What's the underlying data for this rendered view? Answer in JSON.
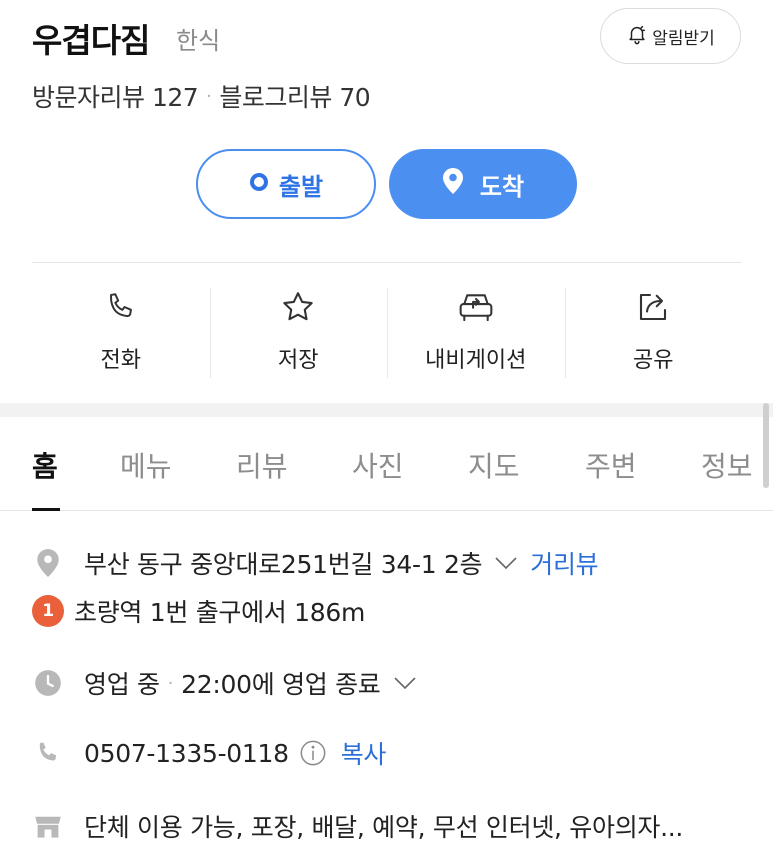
{
  "place": {
    "name": "우겹다짐",
    "category": "한식",
    "alarm_label": "알림받기"
  },
  "reviews": {
    "visitor_label": "방문자리뷰 127",
    "blog_label": "블로그리뷰 70",
    "separator": "·"
  },
  "route": {
    "start_label": "출발",
    "arrive_label": "도착"
  },
  "actions": [
    {
      "label": "전화",
      "icon": "phone-icon"
    },
    {
      "label": "저장",
      "icon": "star-icon"
    },
    {
      "label": "내비게이션",
      "icon": "car-navigation-icon"
    },
    {
      "label": "공유",
      "icon": "share-icon"
    }
  ],
  "tabs": [
    {
      "label": "홈",
      "active": true
    },
    {
      "label": "메뉴"
    },
    {
      "label": "리뷰"
    },
    {
      "label": "사진"
    },
    {
      "label": "지도"
    },
    {
      "label": "주변"
    },
    {
      "label": "정보"
    }
  ],
  "info": {
    "address": "부산 동구 중앙대로251번길 34-1 2층",
    "street_view_label": "거리뷰",
    "subway_badge": "1",
    "subway_text": "초량역 1번 출구에서 186m",
    "status": "영업 중",
    "status_separator": "·",
    "hours_text": "22:00에 영업 종료",
    "phone": "0507-1335-0118",
    "copy_label": "복사",
    "amenities": "단체 이용 가능, 포장, 배달, 예약, 무선 인터넷, 유아의자..."
  },
  "colors": {
    "accent_blue": "#4b8ff1",
    "link_blue": "#2d6fd8",
    "subway_line1": "#e9603a"
  }
}
